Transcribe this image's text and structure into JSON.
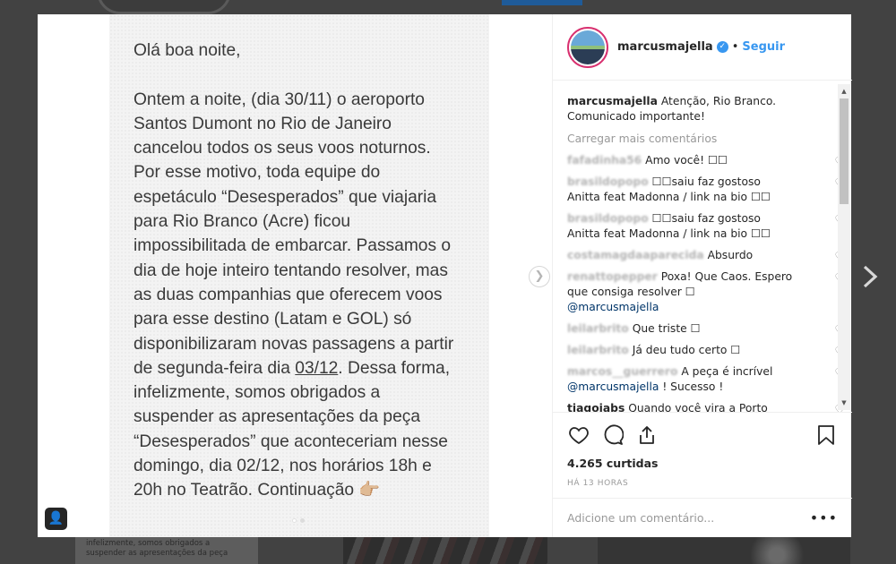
{
  "background": {
    "thumb_text": "infelizmente, somos obrigados a\nsuspender as apresentações da peça"
  },
  "media": {
    "paragraphs": [
      "Olá boa noite,",
      "Ontem a noite, (dia 30/11) o aeroporto\nSantos Dumont no Rio de Janeiro\ncancelou todos os seus voos noturnos.\nPor esse motivo, toda equipe do\nespetáculo “Desesperados” que viajaria\npara Rio Branco (Acre) ficou\nimpossibilitada de embarcar. Passamos o\ndia de hoje inteiro tentando resolver, mas\nas duas companhias que oferecem voos\npara esse destino (Latam e GOL) só\ndisponibilizaram novas passagens a partir\nde segunda-feira dia "
    ],
    "underlined": "03/12",
    "tail": ". Dessa forma,\ninfelizmente, somos obrigados a\nsuspender as apresentações da peça\n“Desesperados” que aconteceriam nesse\ndomingo, dia 02/12, nos horários 18h e\n20h no Teatrão. Continuação 👉🏼",
    "next_icon": "chevron-right-icon"
  },
  "header": {
    "username": "marcusmajella",
    "follow_label": "Seguir",
    "bullet": "•"
  },
  "caption": {
    "username": "marcusmajella",
    "text": "Atenção, Rio Branco. Comunicado importante!"
  },
  "load_more": "Carregar mais comentários",
  "comments": [
    {
      "user": "fafadinha56",
      "text": "Amo você! ☐☐",
      "blur": true
    },
    {
      "user": "brasildopopo",
      "text": "☐☐saiu faz gostoso\nAnitta feat Madonna / link na bio ☐☐",
      "blur": true
    },
    {
      "user": "brasildopopo",
      "text": "☐☐saiu faz gostoso\nAnitta feat Madonna / link na bio ☐☐",
      "blur": true
    },
    {
      "user": "costamagdaaparecida",
      "text": "Absurdo",
      "blur": true
    },
    {
      "user": "renattopepper",
      "text": "Poxa! Que Caos. Espero\nque consiga resolver ☐",
      "mention": "@marcusmajella",
      "blur": true
    },
    {
      "user": "leilarbrito",
      "text": "Que triste ☐",
      "blur": true
    },
    {
      "user": "leilarbrito",
      "text": "Já deu tudo certo ☐",
      "blur": true
    },
    {
      "user": "marcos__guerrero",
      "text": "A peça é incrível",
      "mention": "@marcusmajella",
      "mention_tail": " ! Sucesso !",
      "blur": true
    },
    {
      "user": "tiagojabs",
      "text": "Quando você vira a Porto",
      "blur": false
    }
  ],
  "likes": "4.265 curtidas",
  "time": "HÁ 13 HORAS",
  "add_comment_placeholder": "Adicione um comentário...",
  "more_label": "•••"
}
